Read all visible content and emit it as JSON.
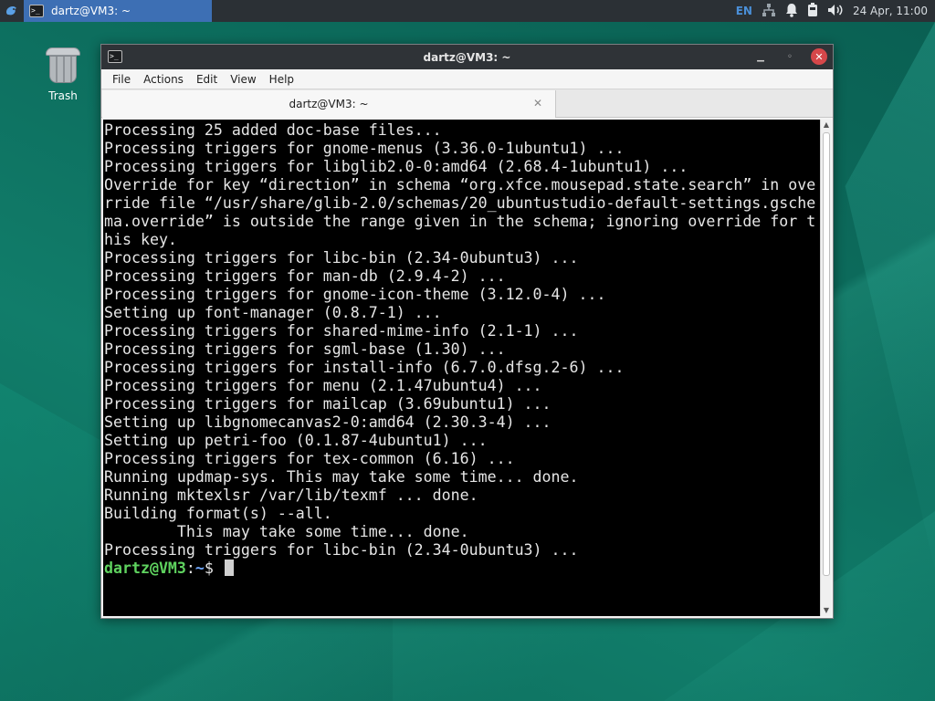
{
  "panel": {
    "task_title": "dartz@VM3: ~",
    "language": "EN",
    "datetime": "24 Apr, 11:00",
    "icons": [
      "xfce-menu-icon",
      "network-icon",
      "notification-bell-icon",
      "battery-icon",
      "volume-icon"
    ]
  },
  "desktop": {
    "trash_label": "Trash"
  },
  "window": {
    "title": "dartz@VM3: ~",
    "menu": [
      "File",
      "Actions",
      "Edit",
      "View",
      "Help"
    ],
    "tab_title": "dartz@VM3: ~",
    "tab_close": "✕"
  },
  "terminal": {
    "lines": [
      "Processing 25 added doc-base files...",
      "Processing triggers for gnome-menus (3.36.0-1ubuntu1) ...",
      "Processing triggers for libglib2.0-0:amd64 (2.68.4-1ubuntu1) ...",
      "Override for key “direction” in schema “org.xfce.mousepad.state.search” in ove",
      "rride file “/usr/share/glib-2.0/schemas/20_ubuntustudio-default-settings.gsche",
      "ma.override” is outside the range given in the schema; ignoring override for t",
      "his key.",
      "Processing triggers for libc-bin (2.34-0ubuntu3) ...",
      "Processing triggers for man-db (2.9.4-2) ...",
      "Processing triggers for gnome-icon-theme (3.12.0-4) ...",
      "Setting up font-manager (0.8.7-1) ...",
      "Processing triggers for shared-mime-info (2.1-1) ...",
      "Processing triggers for sgml-base (1.30) ...",
      "Processing triggers for install-info (6.7.0.dfsg.2-6) ...",
      "Processing triggers for menu (2.1.47ubuntu4) ...",
      "Processing triggers for mailcap (3.69ubuntu1) ...",
      "Setting up libgnomecanvas2-0:amd64 (2.30.3-4) ...",
      "Setting up petri-foo (0.1.87-4ubuntu1) ...",
      "Processing triggers for tex-common (6.16) ...",
      "Running updmap-sys. This may take some time... done.",
      "Running mktexlsr /var/lib/texmf ... done.",
      "Building format(s) --all.",
      "        This may take some time... done.",
      "Processing triggers for libc-bin (2.34-0ubuntu3) ..."
    ],
    "prompt_user": "dartz@VM3",
    "prompt_sep": ":",
    "prompt_path": "~",
    "prompt_symbol": "$ "
  }
}
